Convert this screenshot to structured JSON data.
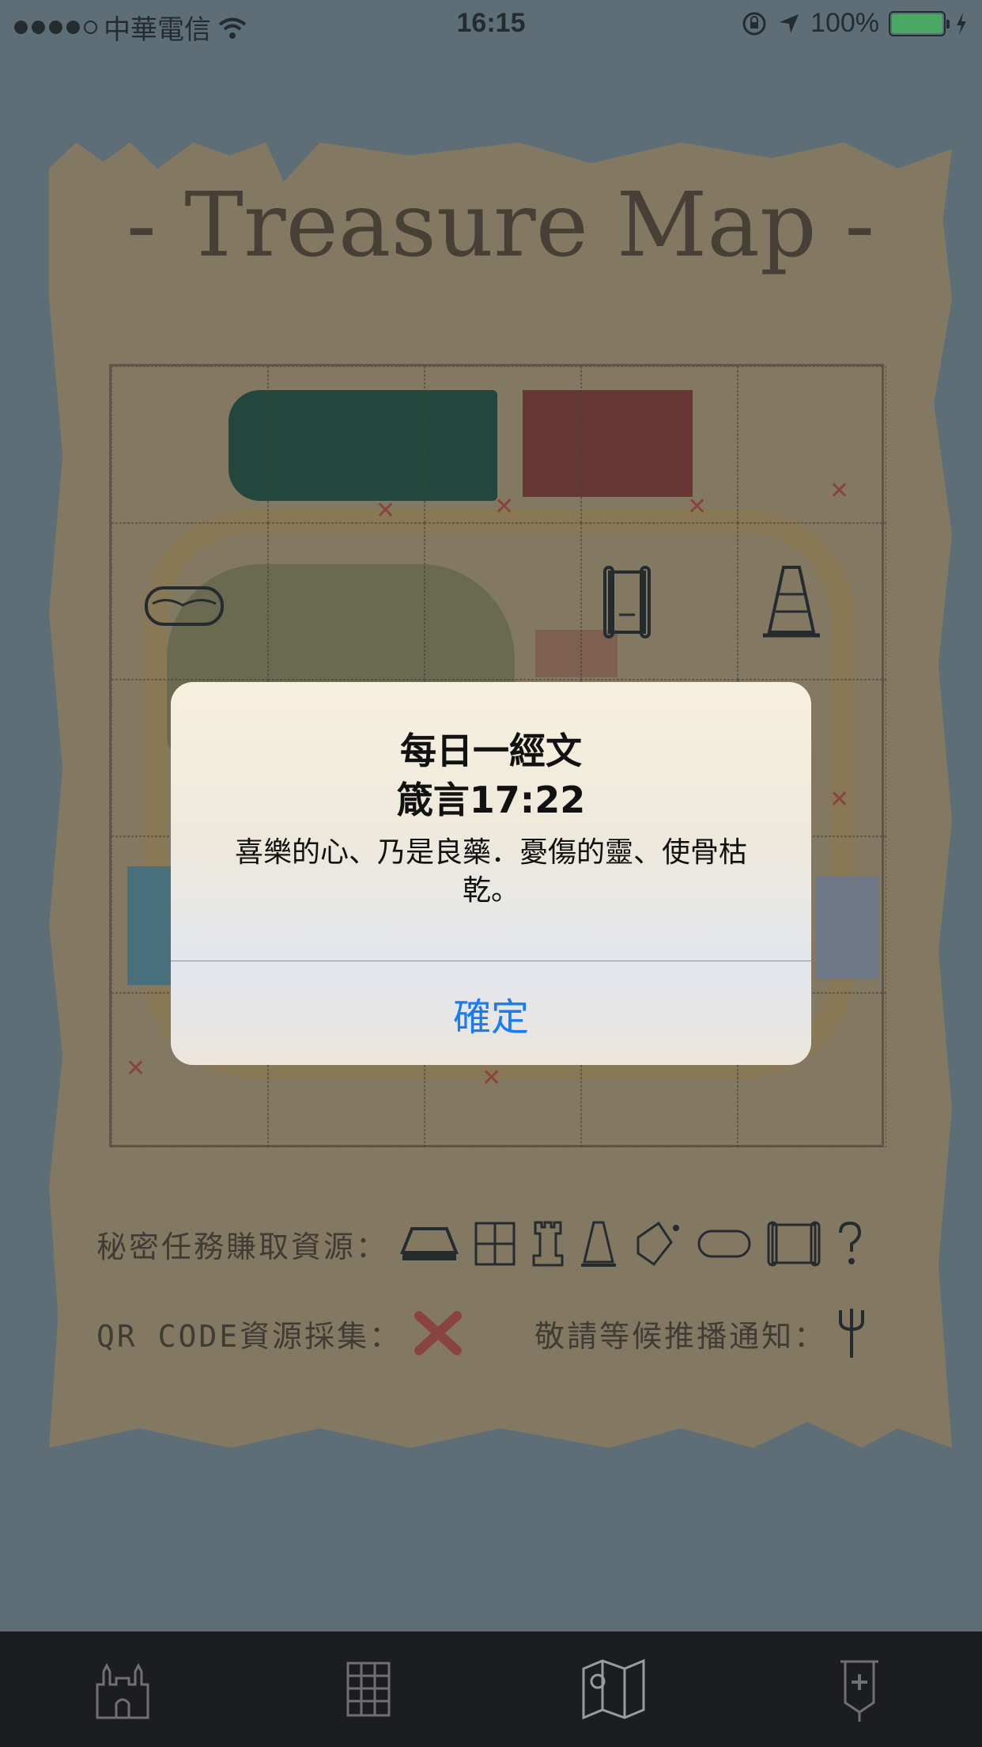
{
  "status_bar": {
    "carrier": "中華電信",
    "time": "16:15",
    "battery": "100%"
  },
  "map": {
    "title": "- Treasure Map -",
    "legend": {
      "missions_label": "秘密任務賺取資源：",
      "missions_icons": [
        "hat-icon",
        "calculator-icon",
        "rook-icon",
        "cone-icon",
        "bucket-icon",
        "goggles-icon",
        "scroll-icon",
        "question-icon"
      ],
      "qr_label": "QR CODE資源採集：",
      "qr_icon": "red-x-icon",
      "push_label": "敬請等候推播通知：",
      "push_icon": "trident-icon"
    }
  },
  "alert": {
    "title_line1": "每日一經文",
    "title_line2": "箴言17:22",
    "message": "喜樂的心、乃是良藥．憂傷的靈、使骨枯乾。",
    "button": "確定"
  },
  "tab_bar": {
    "tabs": [
      "castle-icon",
      "grid-icon",
      "map-icon",
      "banner-icon"
    ],
    "selected_index": 2
  }
}
